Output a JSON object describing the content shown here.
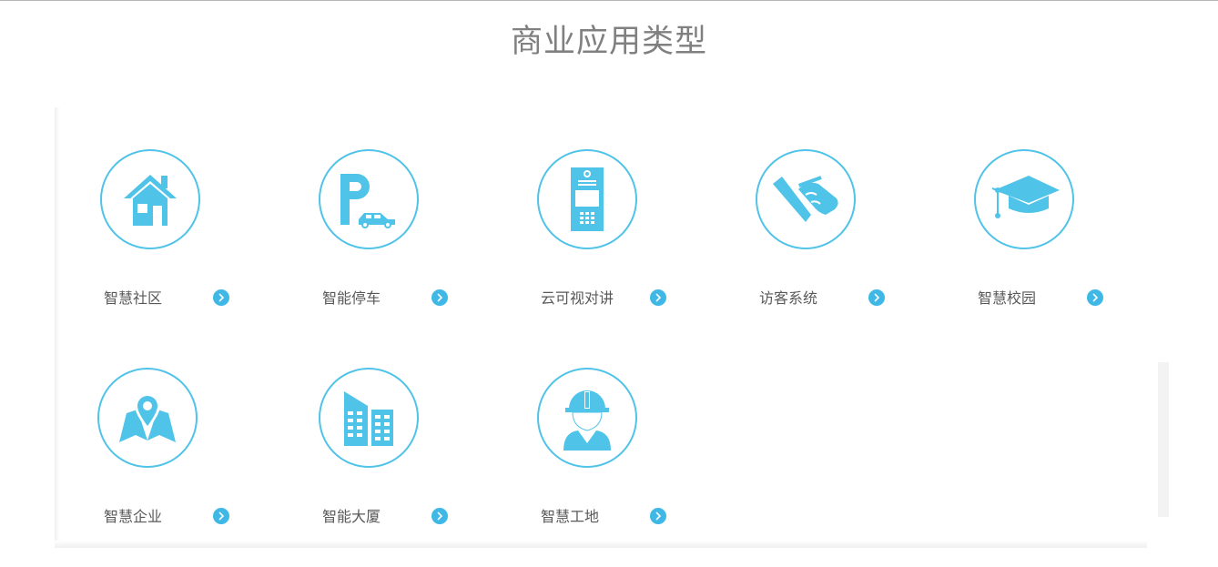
{
  "page": {
    "title": "商业应用类型"
  },
  "colors": {
    "accent": "#4fc3e8",
    "arrow": "#3fb8e5",
    "label": "#595959",
    "title": "#808080"
  },
  "cards": [
    {
      "label": "智慧社区",
      "icon": "house-icon"
    },
    {
      "label": "智能停车",
      "icon": "parking-car-icon"
    },
    {
      "label": "云可视对讲",
      "icon": "intercom-panel-icon"
    },
    {
      "label": "访客系统",
      "icon": "pen-signing-icon"
    },
    {
      "label": "智慧校园",
      "icon": "graduation-cap-icon"
    },
    {
      "label": "智慧企业",
      "icon": "map-pin-icon"
    },
    {
      "label": "智能大厦",
      "icon": "buildings-icon"
    },
    {
      "label": "智慧工地",
      "icon": "worker-helmet-icon"
    }
  ]
}
